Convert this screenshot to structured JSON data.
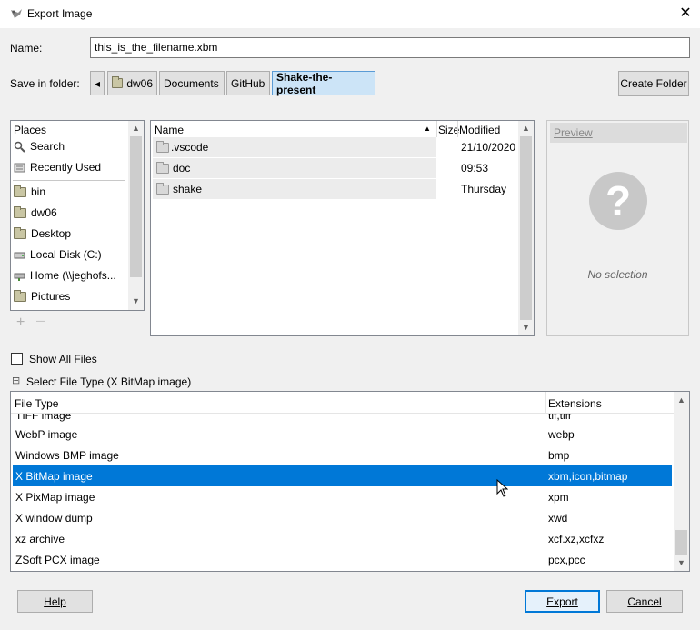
{
  "window": {
    "title": "Export Image",
    "close_glyph": "✕"
  },
  "name_row": {
    "label": "Name:",
    "value": "this_is_the_filename.xbm"
  },
  "folder_row": {
    "label": "Save in folder:",
    "back_glyph": "◂",
    "crumbs": [
      "dw06",
      "Documents",
      "GitHub",
      "Shake-the-present"
    ],
    "create_folder": "Create Folder"
  },
  "places": {
    "header": "Places",
    "items": [
      "Search",
      "Recently Used",
      "bin",
      "dw06",
      "Desktop",
      "Local Disk (C:)",
      "Home (\\\\jeghofs...",
      "Pictures"
    ],
    "add": "+",
    "remove": "—"
  },
  "files": {
    "col_name": "Name",
    "col_size": "Size",
    "col_modified": "Modified",
    "sort_glyph": "▲",
    "rows": [
      {
        "name": ".vscode",
        "modified": "21/10/2020"
      },
      {
        "name": "doc",
        "modified": "09:53"
      },
      {
        "name": "shake",
        "modified": "Thursday"
      }
    ]
  },
  "preview": {
    "header": "Preview",
    "empty": "No selection",
    "glyph": "?"
  },
  "show_all": {
    "label": "Show All Files"
  },
  "file_type": {
    "expander": "⊟",
    "label": "Select File Type (X BitMap image)",
    "col_type": "File Type",
    "col_ext": "Extensions",
    "partial_name": "TIFF image",
    "partial_ext": "tif,tiff",
    "rows": [
      {
        "name": "WebP image",
        "ext": "webp"
      },
      {
        "name": "Windows BMP image",
        "ext": "bmp"
      },
      {
        "name": "X BitMap image",
        "ext": "xbm,icon,bitmap"
      },
      {
        "name": "X PixMap image",
        "ext": "xpm"
      },
      {
        "name": "X window dump",
        "ext": "xwd"
      },
      {
        "name": "xz archive",
        "ext": "xcf.xz,xcfxz"
      },
      {
        "name": "ZSoft PCX image",
        "ext": "pcx,pcc"
      }
    ]
  },
  "buttons": {
    "help": "Help",
    "export": "Export",
    "cancel": "Cancel"
  }
}
